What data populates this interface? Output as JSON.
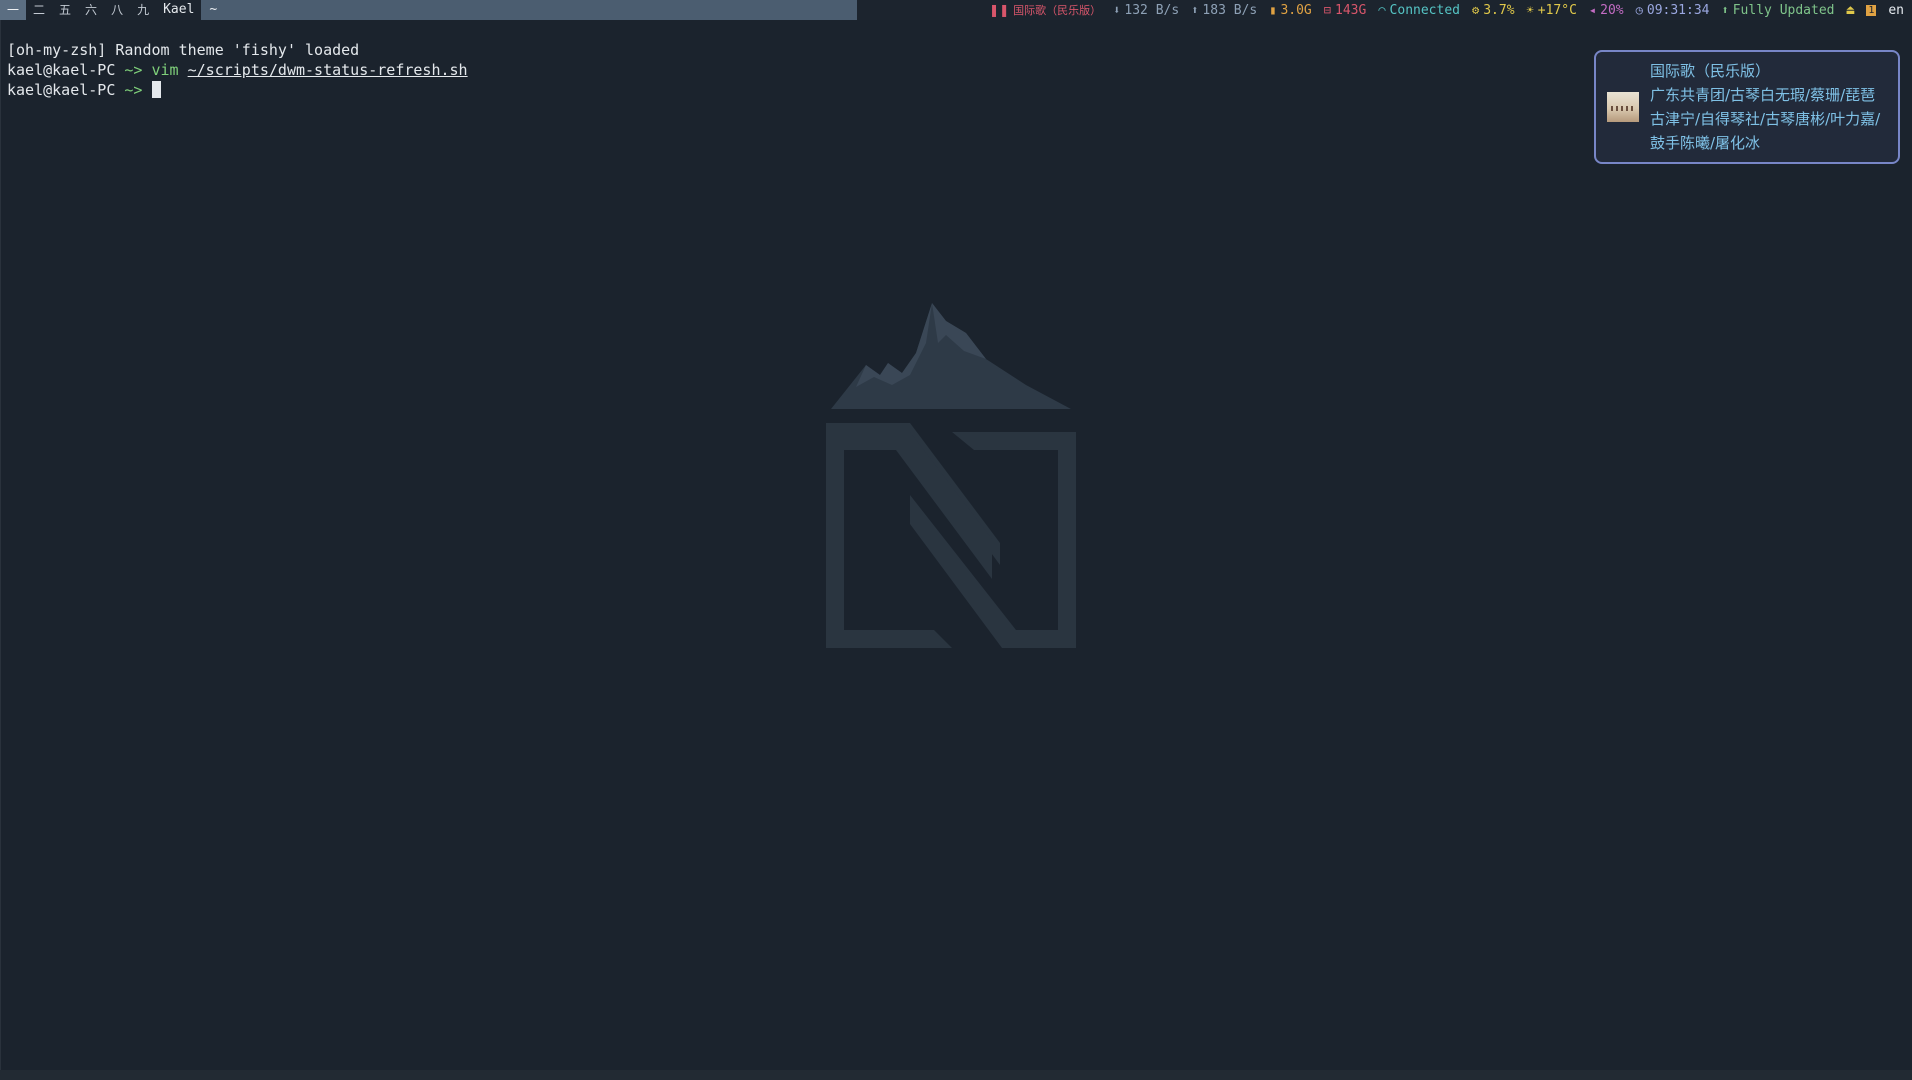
{
  "bar": {
    "tags": [
      "一",
      "二",
      "五",
      "六",
      "八",
      "九"
    ],
    "active_tag_index": 0,
    "window_title": "Kael",
    "layout_symbol": "~"
  },
  "status": {
    "music": "国际歌（民乐版）",
    "net_down": "132 B/s",
    "net_up": "183 B/s",
    "mem": "3.0G",
    "disk": "143G",
    "wifi": "Connected",
    "cpu": "3.7%",
    "temp": "+17°C",
    "volume": "20%",
    "clock": "09:31:34",
    "updates": "Fully Updated",
    "caps_icon": "⏏",
    "kb_icon": "1",
    "lang": "en"
  },
  "terminal": {
    "line1": "[oh-my-zsh] Random theme 'fishy' loaded",
    "prompt_user": "kael@kael-PC",
    "prompt_path": " ~> ",
    "cmd": "vim",
    "arg": "~/scripts/dwm-status-refresh.sh",
    "line3_user": "kael@kael-PC",
    "line3_path": " ~> "
  },
  "notification": {
    "title": "国际歌（民乐版）",
    "body": "广东共青团/古琴白无瑕/蔡珊/琵琶古津宁/自得琴社/古琴唐彬/叶力嘉/鼓手陈曦/屠化冰"
  },
  "colors": {
    "background": "#1b232d",
    "accent": "#7886c7",
    "prompt_green": "#7fd07a"
  }
}
